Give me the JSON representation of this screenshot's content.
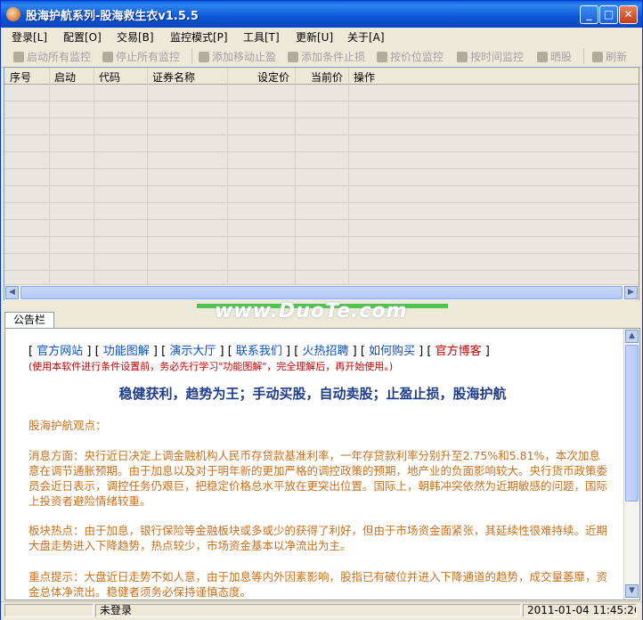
{
  "window": {
    "title": "股海护航系列-股海救生衣v1.5.5"
  },
  "menu": [
    {
      "label": "登录[L]"
    },
    {
      "label": "配置[O]"
    },
    {
      "label": "交易[B]"
    },
    {
      "label": "监控模式[P]"
    },
    {
      "label": "工具[T]"
    },
    {
      "label": "更新[U]"
    },
    {
      "label": "关于[A]"
    }
  ],
  "toolbar": [
    {
      "label": "启动所有监控",
      "icon": "play-icon"
    },
    {
      "label": "停止所有监控",
      "icon": "stop-icon"
    },
    {
      "label": "添加移动止盈",
      "icon": "add-trailing-icon"
    },
    {
      "label": "添加条件止损",
      "icon": "add-condition-icon"
    },
    {
      "label": "按价位监控",
      "icon": "price-monitor-icon"
    },
    {
      "label": "按时间监控",
      "icon": "time-monitor-icon"
    },
    {
      "label": "晒股",
      "icon": "share-icon"
    },
    {
      "label": "刷新",
      "icon": "refresh-icon"
    }
  ],
  "grid": {
    "columns": [
      "序号",
      "启动",
      "代码",
      "证券名称",
      "设定价",
      "当前价",
      "操作"
    ],
    "rows": []
  },
  "watermark": "www.DuoTe.com",
  "tab": {
    "label": "公告栏"
  },
  "announcement": {
    "links": [
      "官方网站",
      "功能图解",
      "演示大厅",
      "联系我们",
      "火热招聘",
      "如何购买",
      "官方博客"
    ],
    "warning": "(使用本软件进行条件设置前，务必先行学习\"功能图解\"，完全理解后，再开始使用。)",
    "slogan": "稳健获利，趋势为王；手动买股，自动卖股；止盈止损，股海护航",
    "paragraphs": [
      "股海护航观点：",
      "消息方面：央行近日决定上调金融机构人民币存贷款基准利率，一年存贷款利率分别升至2.75%和5.81%，本次加息意在调节通胀预期。由于加息以及对于明年新的更加严格的调控政策的预期，地产业的负面影响较大。央行货币政策委员会近日表示，调控任务仍艰巨，把稳定价格总水平放在更突出位置。国际上，朝韩冲突依然为近期敏感的问题，国际上投资者避险情绪较重。",
      "板块热点：由于加息，银行保险等金融板块或多或少的获得了利好，但由于市场资金面紧张，其延续性很难持续。近期大盘走势进入下降趋势，热点较少，市场资金基本以净流出为主。",
      "重点提示：大盘近日走势不如人意，由于加息等内外因素影响，股指已有破位并进入下降通道的趋势，成交量萎靡，资金总体净流出。稳健者须务必保持谨慎态度。"
    ]
  },
  "status": {
    "login": "未登录",
    "datetime": "2011-01-04 11:45:26"
  }
}
